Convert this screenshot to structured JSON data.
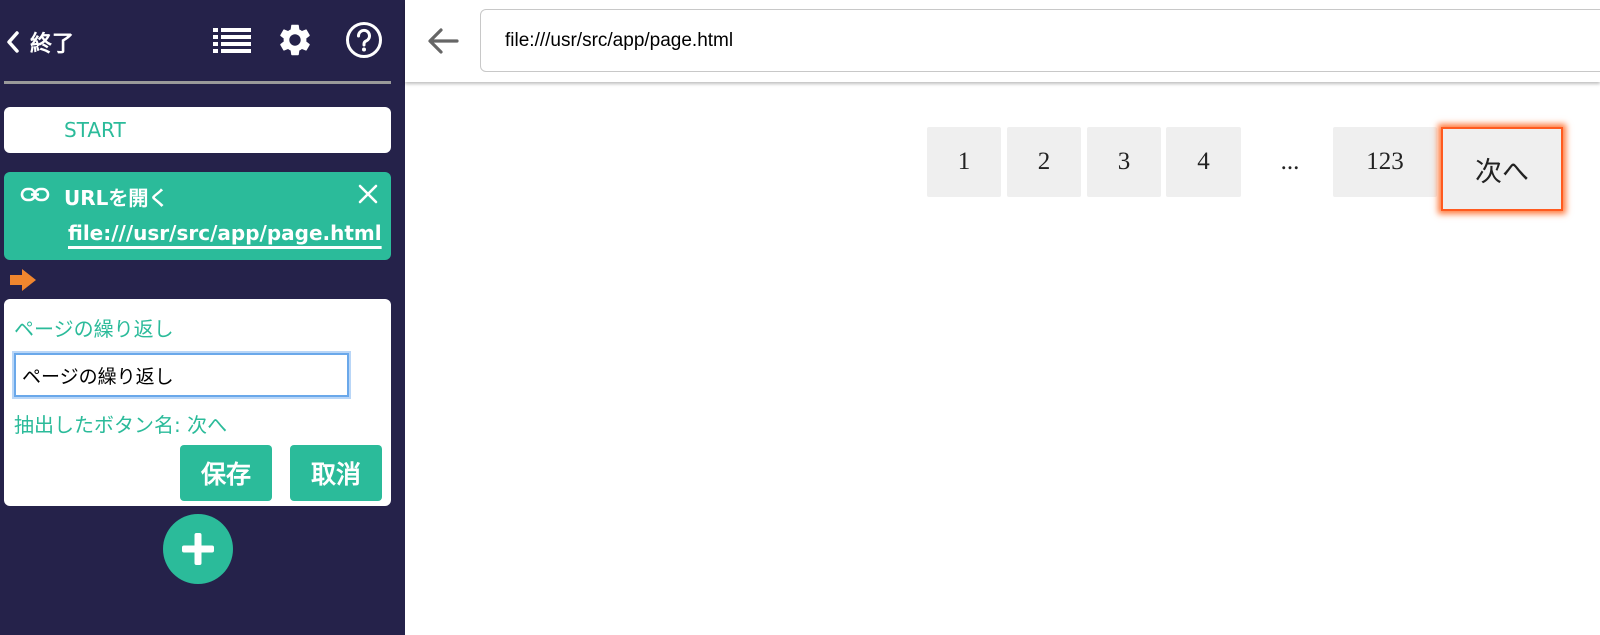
{
  "sidebar": {
    "back_label": "終了",
    "start_label": "START",
    "url_step": {
      "title": "URLを開く",
      "url": "file:///usr/src/app/page.html"
    },
    "edit_step": {
      "title": "ページの繰り返し",
      "input_value": "ページの繰り返し",
      "info": "抽出したボタン名: 次へ",
      "save_label": "保存",
      "cancel_label": "取消"
    }
  },
  "browser": {
    "address": "file:///usr/src/app/page.html",
    "pagination": {
      "pages": [
        "1",
        "2",
        "3",
        "4"
      ],
      "ellipsis": "...",
      "last": "123",
      "next": "次へ"
    }
  },
  "colors": {
    "sidebar_bg": "#25224a",
    "accent": "#2bbb9a",
    "highlight": "#ff5a1f",
    "arrow": "#f0862e"
  },
  "icons": [
    "chevron-left-icon",
    "list-icon",
    "gear-icon",
    "help-icon",
    "link-icon",
    "close-icon",
    "arrow-right-icon",
    "plus-icon",
    "back-arrow-icon"
  ]
}
